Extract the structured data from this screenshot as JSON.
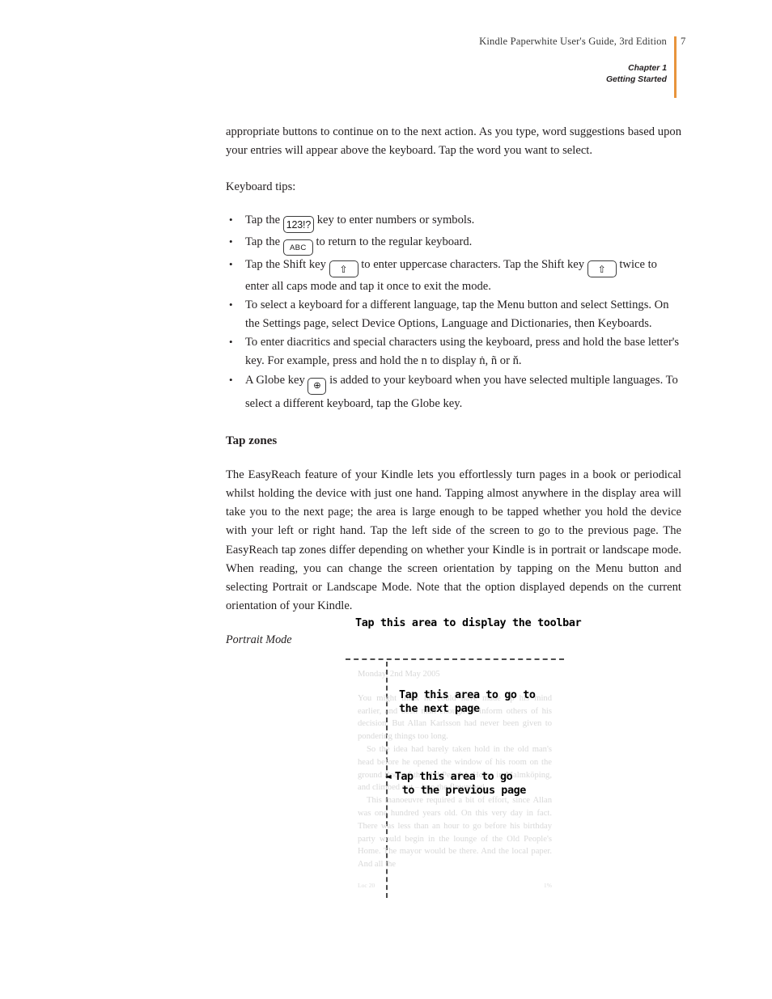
{
  "header": {
    "title": "Kindle Paperwhite User's Guide, 3rd Edition",
    "page_number": "7",
    "chapter_line1": "Chapter 1",
    "chapter_line2": "Getting Started",
    "rule_color": "#e8943c"
  },
  "body": {
    "intro_paragraph": "appropriate buttons to continue on to the next action. As you type, word suggestions based upon your entries will appear above the keyboard. Tap the word you want to select.",
    "keyboard_tips_label": "Keyboard tips:",
    "bullets": [
      {
        "before": "Tap the ",
        "key": "123!?",
        "key_name": "numbers-symbols-key",
        "after": " key to enter numbers or symbols."
      },
      {
        "before": "Tap the ",
        "key": "ABC",
        "key_name": "abc-key",
        "after": " to return to the regular keyboard."
      },
      {
        "before": "Tap the Shift key ",
        "key": "⇧",
        "key_name": "shift-key",
        "middle": " to enter uppercase characters. Tap the Shift key ",
        "key2": "⇧",
        "key2_name": "shift-key",
        "after": " twice to enter all caps mode and tap it once to exit the mode."
      },
      {
        "text": "To select a keyboard for a different language, tap the Menu button and select Settings. On the Settings page, select Device Options, Language and Dictionaries, then Keyboards."
      },
      {
        "text": "To enter diacritics and special characters using the keyboard, press and hold the base letter's key. For example, press and hold the n to display ṅ, ñ or ň."
      },
      {
        "before": "A Globe key ",
        "key": "⊕",
        "key_name": "globe-key",
        "after": " is added to your keyboard when you have selected multiple languages. To select a different keyboard, tap the Globe key."
      }
    ],
    "section_title": "Tap zones",
    "tapzones_paragraph": "The EasyReach feature of your Kindle lets you effortlessly turn pages in a book or periodical whilst holding the device with just one hand. Tapping almost anywhere in the display area will take you to the next page; the area is large enough to be tapped whether you hold the device with your left or right hand. Tap the left side of the screen to go to the previous page. The EasyReach tap zones differ depending on whether your Kindle is in portrait or landscape mode. When reading, you can change the screen orientation by tapping on the Menu button and selecting Portrait or Landscape Mode. Note that the option displayed depends on the current orientation of your Kindle.",
    "portrait_mode_caption": "Portrait Mode"
  },
  "diagram": {
    "toolbar_label": "Tap this area to display the toolbar",
    "next_page_label": "Tap this area to go to\nthe next page",
    "next_page_line1": "Tap this area to go to",
    "next_page_line2": "the next page",
    "prev_page_line1": "Tap this area to go",
    "prev_page_line2": "to the previous page",
    "prev_arrow": "◄",
    "book_date": "Monday, 2nd May 2005",
    "book_paragraph_1": "You might think he could have made up his mind earlier, and been man enough to inform others of his decision. But Allan Karlsson had never been given to pondering things too long.",
    "book_paragraph_2": "So the idea had barely taken hold in the old man's head before he opened the window of his room on the ground floor of the Old People's Home in Malmköping, and climbed out – into the flowerbed.",
    "book_paragraph_3": "This manoeuvre required a bit of effort, since Allan was one hundred years old. On this very day in fact. There was less than an hour to go before his birthday party would begin in the lounge of the Old People's Home. The mayor would be there. And the local paper. And all the",
    "footer_location": "Loc 20",
    "footer_percent": "1%"
  }
}
